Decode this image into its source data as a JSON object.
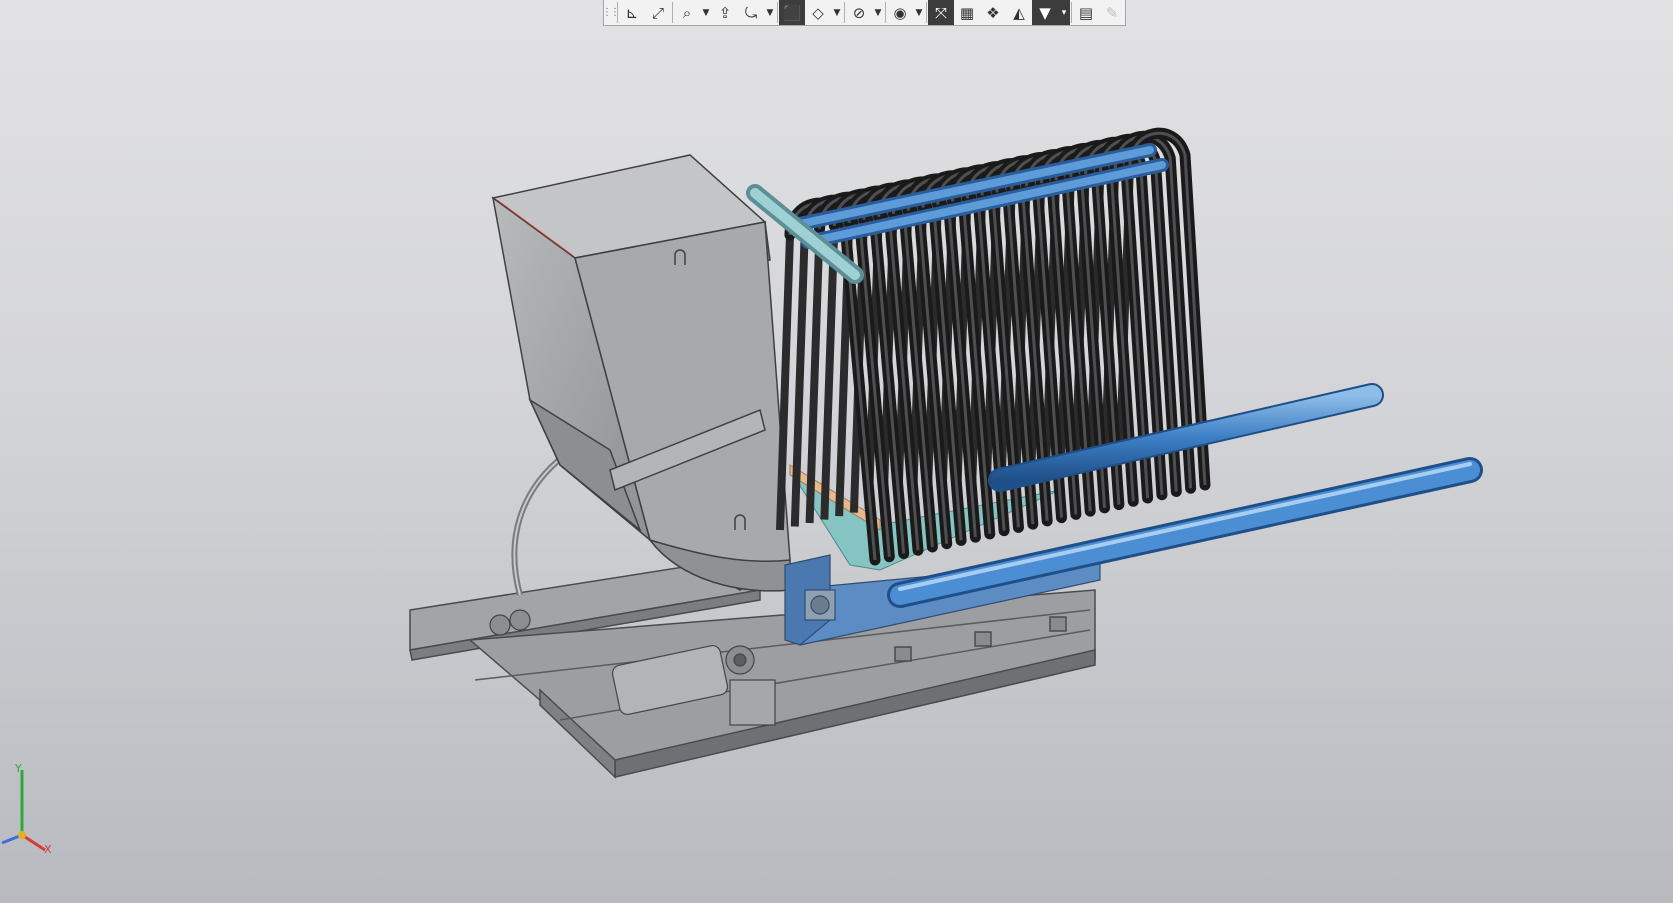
{
  "toolbar": {
    "buttons": [
      {
        "icon": "grip-icon",
        "glyph": "⠿",
        "active": false
      },
      {
        "icon": "orient-axes-icon",
        "glyph": "⊾",
        "active": false
      },
      {
        "icon": "zoom-previous-icon",
        "glyph": "⤢",
        "active": false
      },
      {
        "icon": "zoom-window-icon",
        "glyph": "⌕",
        "active": false
      },
      {
        "icon": "pan-icon",
        "glyph": "⇪",
        "active": false
      },
      {
        "icon": "rotate-icon",
        "glyph": "⤿",
        "active": false
      },
      {
        "icon": "shaded-display-icon",
        "glyph": "◼",
        "active": true
      },
      {
        "icon": "wireframe-display-icon",
        "glyph": "◇",
        "active": false
      },
      {
        "icon": "hide-show-icon",
        "glyph": "⊘",
        "active": false
      },
      {
        "icon": "view-settings-icon",
        "glyph": "◉",
        "active": false
      },
      {
        "icon": "perspective-icon",
        "glyph": "⤧",
        "active": true
      },
      {
        "icon": "section-icon",
        "glyph": "▦",
        "active": false
      },
      {
        "icon": "appearance-icon",
        "glyph": "❖",
        "active": false
      },
      {
        "icon": "scene-icon",
        "glyph": "▲",
        "active": false
      },
      {
        "icon": "filter-icon",
        "glyph": "▼",
        "active": true
      },
      {
        "icon": "properties-icon",
        "glyph": "▤",
        "active": false
      },
      {
        "icon": "eyedropper-icon",
        "glyph": "✎",
        "active": false
      }
    ]
  },
  "triad": {
    "y_label": "Y",
    "x_label": "X"
  },
  "colors": {
    "background_top": "#e2e2e4",
    "background_bottom": "#b8bac0",
    "steel": "#a9aaab",
    "steel_dark": "#6e6f71",
    "pipe_blue": "#3d7fc6",
    "coil_black": "#2b2b2c",
    "frame_blue": "#5d8cc4",
    "teal": "#86c4c4"
  }
}
